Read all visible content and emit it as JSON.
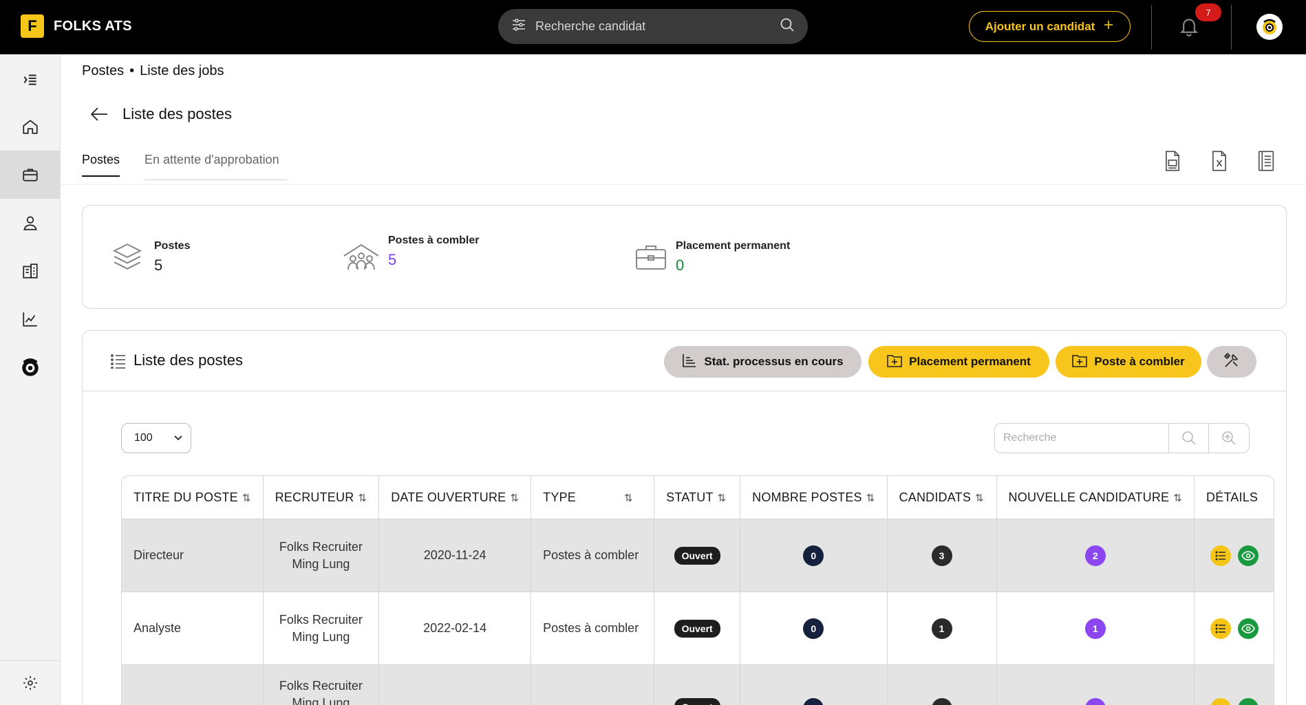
{
  "app": {
    "brand_letter": "F",
    "brand_name": "FOLKS ATS"
  },
  "topbar": {
    "search_placeholder": "Recherche candidat",
    "add_candidate_label": "Ajouter un candidat",
    "notification_count": "7"
  },
  "breadcrumb": {
    "section": "Postes",
    "current": "Liste des jobs"
  },
  "page": {
    "title": "Liste des postes"
  },
  "tabs": [
    {
      "label": "Postes",
      "active": true
    },
    {
      "label": "En attente d'approbation",
      "active": false
    }
  ],
  "stats": [
    {
      "label": "Postes",
      "value": "5",
      "color": "#222222",
      "icon": "layers-icon"
    },
    {
      "label": "Postes à combler",
      "value": "5",
      "color": "#7b3ff2",
      "icon": "group-icon"
    },
    {
      "label": "Placement permanent",
      "value": "0",
      "color": "#138a36",
      "icon": "briefcase-icon"
    }
  ],
  "list": {
    "title": "Liste des postes",
    "buttons": {
      "stats": "Stat. processus en cours",
      "permanent": "Placement permanent",
      "to_fill": "Poste à combler"
    },
    "page_size": "100",
    "search_placeholder": "Recherche"
  },
  "table": {
    "columns": [
      "TITRE DU POSTE",
      "RECRUTEUR",
      "DATE OUVERTURE",
      "TYPE",
      "STATUT",
      "NOMBRE POSTES",
      "CANDIDATS",
      "NOUVELLE CANDIDATURE",
      "DÉTAILS"
    ],
    "rows": [
      {
        "title": "Directeur",
        "recruiter_line1": "Folks Recruiter",
        "recruiter_line2": "Ming Lung",
        "date": "2020-11-24",
        "type": "Postes à combler",
        "status": "Ouvert",
        "positions": "0",
        "candidates": "3",
        "new_applications": "2"
      },
      {
        "title": "Analyste",
        "recruiter_line1": "Folks Recruiter",
        "recruiter_line2": "Ming Lung",
        "date": "2022-02-14",
        "type": "Postes à combler",
        "status": "Ouvert",
        "positions": "0",
        "candidates": "1",
        "new_applications": "1"
      },
      {
        "title": "",
        "recruiter_line1": "Folks Recruiter",
        "recruiter_line2": "Ming Lung",
        "date": "",
        "type": "",
        "status": "Ouvert",
        "positions": "",
        "candidates": "",
        "new_applications": ""
      }
    ]
  }
}
